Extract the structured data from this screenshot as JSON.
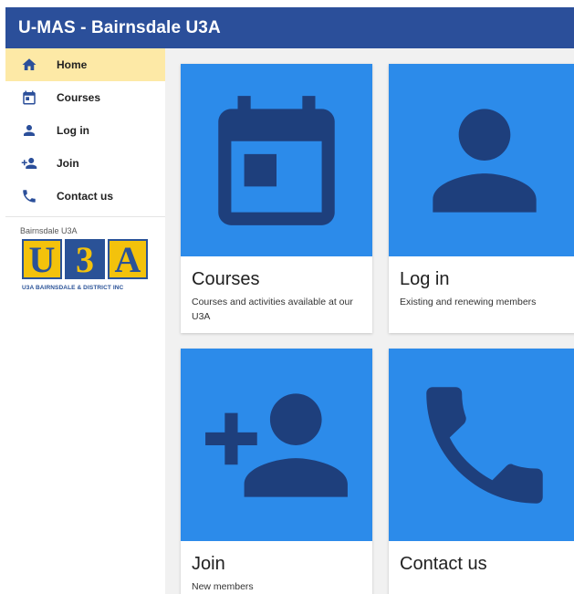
{
  "app_bar": {
    "title": "U-MAS - Bairnsdale U3A",
    "color": "#2b4f9a"
  },
  "sidebar": {
    "items": [
      {
        "label": "Home",
        "icon": "home-icon",
        "active": true
      },
      {
        "label": "Courses",
        "icon": "calendar-icon"
      },
      {
        "label": "Log in",
        "icon": "person-icon"
      },
      {
        "label": "Join",
        "icon": "person-add-icon"
      },
      {
        "label": "Contact us",
        "icon": "phone-icon"
      }
    ],
    "org_name": "Bairnsdale U3A",
    "logo": {
      "letters": [
        "U",
        "3",
        "A"
      ],
      "caption": "U3A BAIRNSDALE & DISTRICT INC"
    },
    "active_color": "#fde9a6"
  },
  "cards": [
    {
      "title": "Courses",
      "subtitle": "Courses and activities available at our U3A",
      "icon": "calendar-icon"
    },
    {
      "title": "Log in",
      "subtitle": "Existing and renewing members",
      "icon": "person-icon"
    },
    {
      "title": "Join",
      "subtitle": "New members",
      "icon": "person-add-icon"
    },
    {
      "title": "Contact us",
      "subtitle": "",
      "icon": "phone-icon"
    }
  ],
  "colors": {
    "card_media": "#2c8bea",
    "icon_dark": "#1e3f7c",
    "accent": "#2b4f9a"
  }
}
